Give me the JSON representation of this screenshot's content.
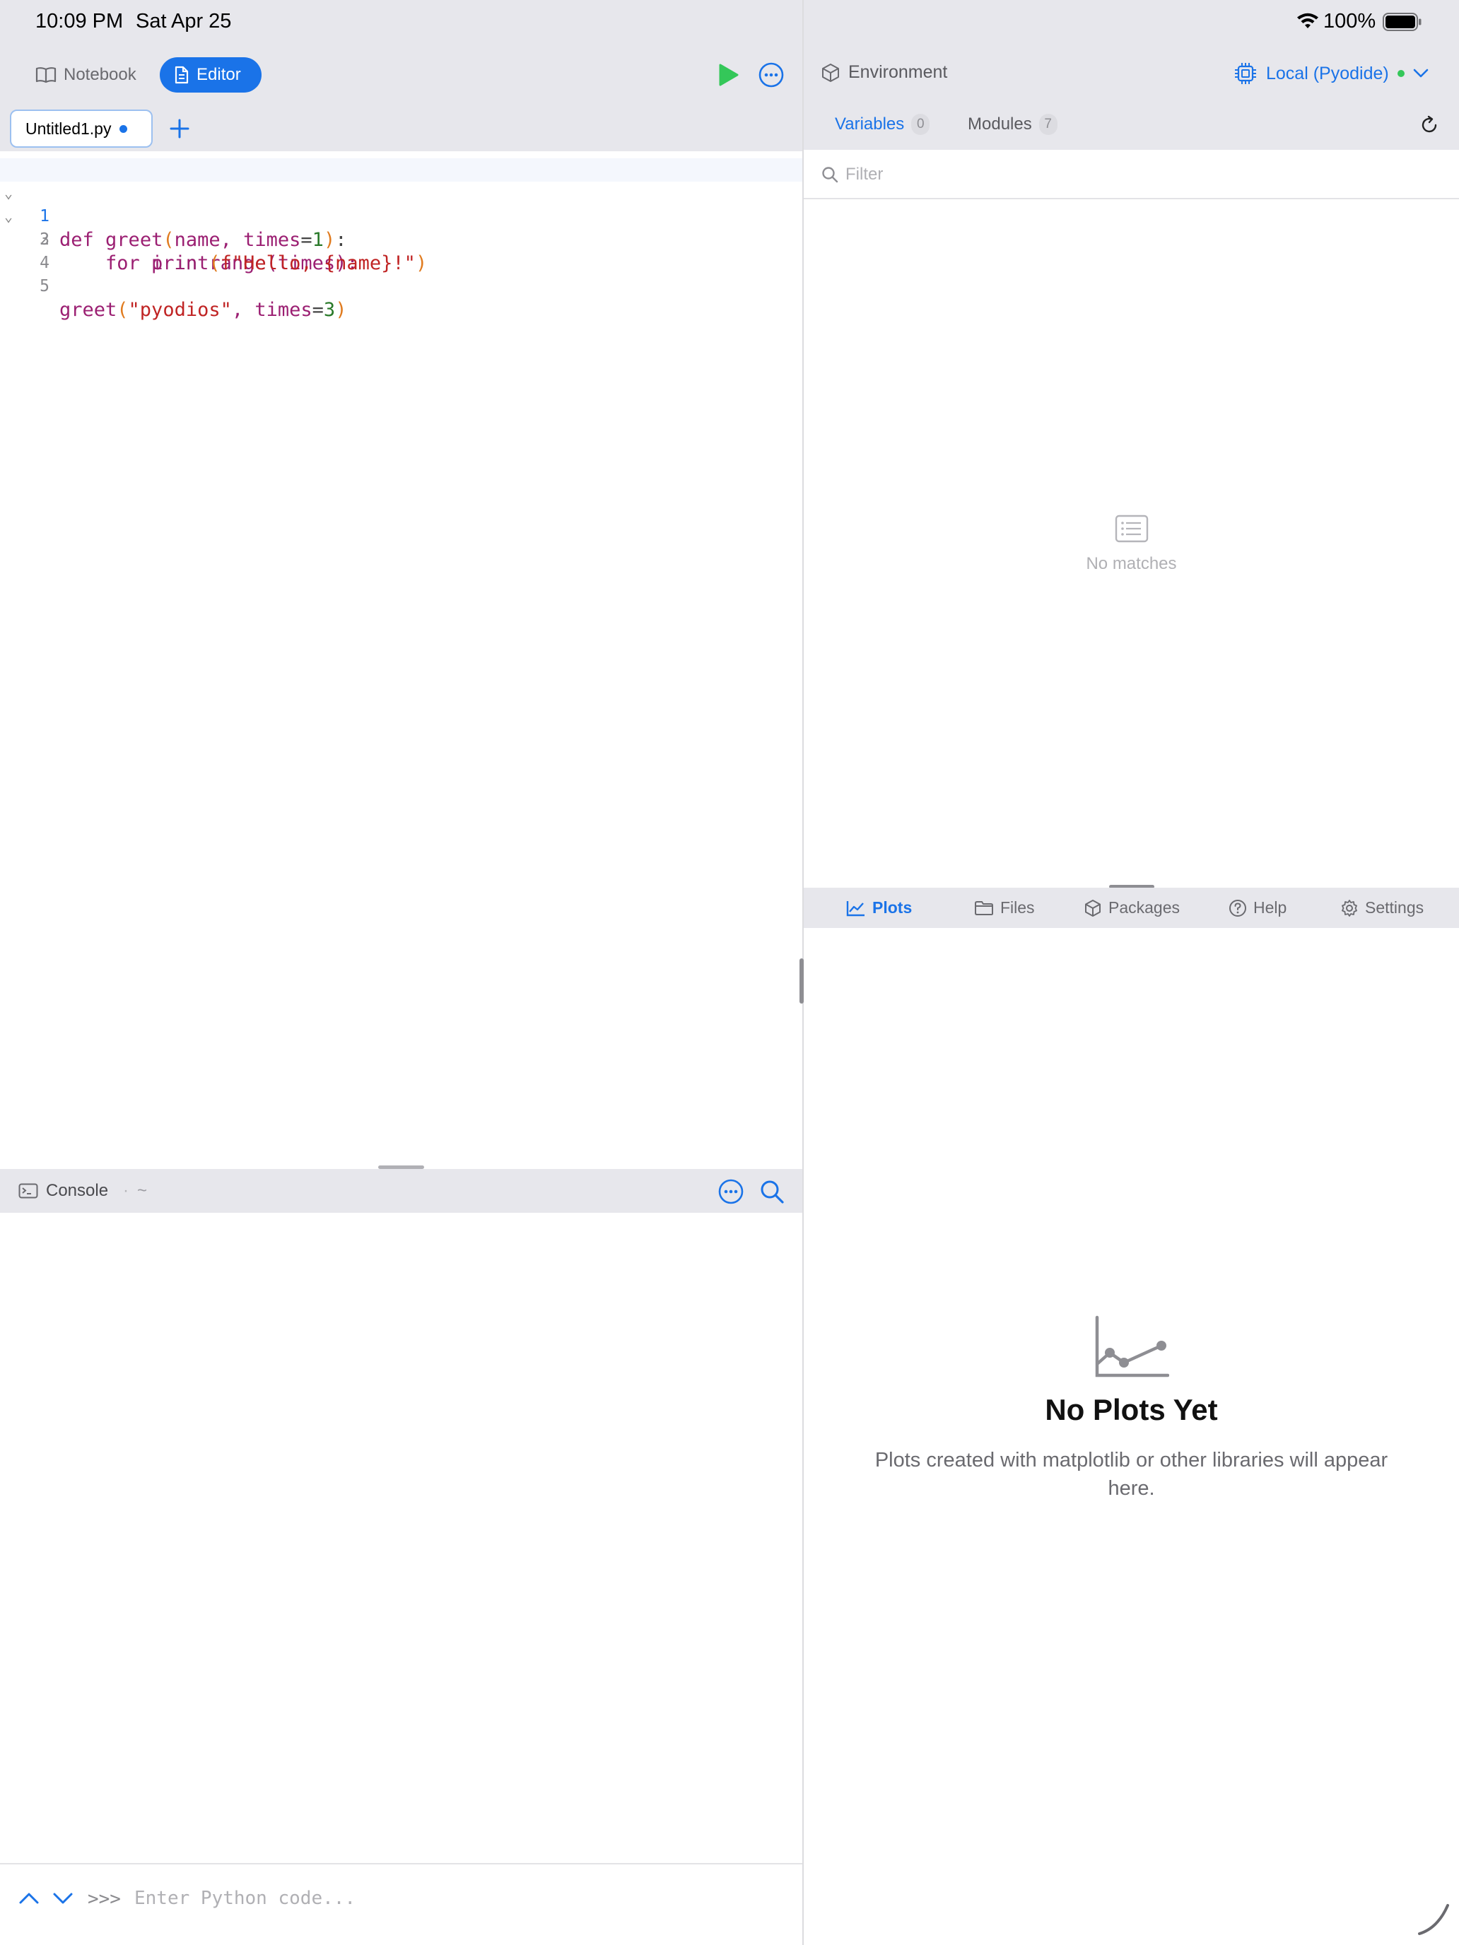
{
  "status_bar": {
    "time": "10:09 PM",
    "date": "Sat Apr 25",
    "battery": "100%"
  },
  "editor": {
    "mode_tabs": {
      "notebook": "Notebook",
      "editor": "Editor",
      "active": "editor"
    },
    "file_tab": {
      "name": "Untitled1.py",
      "modified": true
    },
    "line_numbers": [
      "1",
      "2",
      "3",
      "4",
      "5"
    ],
    "code_lines": [
      "def greet(name, times=1):",
      "    for i in range(times):",
      "        print(f\"Hello, {name}!\")",
      "",
      "greet(\"pyodios\", times=3)"
    ],
    "tokens": {
      "l1": [
        "def",
        " ",
        "greet",
        "(",
        "name, times",
        "=",
        "1",
        ")",
        ":"
      ],
      "l2": [
        "    ",
        "for",
        " i ",
        "in",
        " ",
        "range",
        "(times):"
      ],
      "l3": [
        "        ",
        "print",
        "(",
        "f\"Hello, {name}!\"",
        ")"
      ],
      "l5": [
        "greet",
        "(",
        "\"pyodios\"",
        ", times",
        "=",
        "3",
        ")"
      ]
    }
  },
  "console": {
    "title": "Console",
    "separator": "·",
    "path": "~",
    "prompt": ">>>",
    "input_placeholder": "Enter Python code...",
    "input_value": ""
  },
  "environment": {
    "title": "Environment",
    "kernel": "Local (Pyodide)",
    "kernel_status_color": "#34c759",
    "tabs": [
      {
        "label": "Variables",
        "count": "0",
        "active": true
      },
      {
        "label": "Modules",
        "count": "7",
        "active": false
      }
    ],
    "filter_placeholder": "Filter",
    "empty_text": "No matches"
  },
  "bottom_panel": {
    "tabs": [
      {
        "label": "Plots",
        "icon": "chart-line-icon",
        "active": true
      },
      {
        "label": "Files",
        "icon": "folder-icon",
        "active": false
      },
      {
        "label": "Packages",
        "icon": "package-icon",
        "active": false
      },
      {
        "label": "Help",
        "icon": "question-circle-icon",
        "active": false
      },
      {
        "label": "Settings",
        "icon": "gear-icon",
        "active": false
      }
    ],
    "empty_title": "No Plots Yet",
    "empty_description": "Plots created with matplotlib or other libraries will appear here."
  },
  "colors": {
    "accent": "#1a73e8",
    "run": "#34c759",
    "chrome": "#e7e7ec"
  }
}
